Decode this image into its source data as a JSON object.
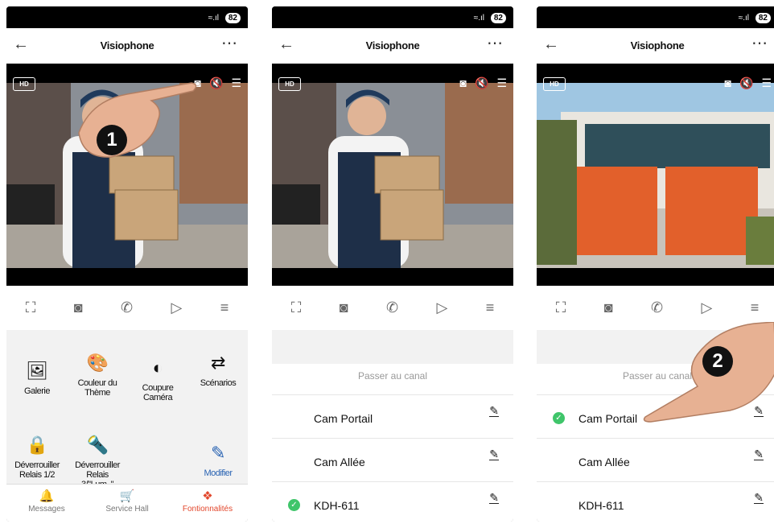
{
  "status": {
    "battery": "82",
    "signal": "≈.ıl"
  },
  "header": {
    "title": "Visiophone",
    "back": "←",
    "more": "⋯"
  },
  "video": {
    "hd": "HD"
  },
  "features": [
    {
      "label": "Galerie",
      "icon": "🖼"
    },
    {
      "label": "Couleur du Thème",
      "icon": "🎨"
    },
    {
      "label": "Coupure Caméra",
      "icon": "◐"
    },
    {
      "label": "Scénarios",
      "icon": "⇄"
    },
    {
      "label": "Déverrouiller Relais 1/2",
      "icon": "🔒"
    },
    {
      "label": "Déverrouiller Relais 3/\"Lum..\"",
      "icon": "🔦"
    },
    {
      "label": "Modifier",
      "icon": "✎"
    }
  ],
  "tabs": [
    {
      "label": "Messages",
      "icon": "🔔"
    },
    {
      "label": "Service Hall",
      "icon": "🛒"
    },
    {
      "label": "Fontionnalités",
      "icon": "❖"
    }
  ],
  "sheet": {
    "title": "Passer au canal"
  },
  "channels": [
    "Cam Portail",
    "Cam Allée",
    "KDH-611"
  ],
  "steps": {
    "one": "1",
    "two": "2"
  }
}
